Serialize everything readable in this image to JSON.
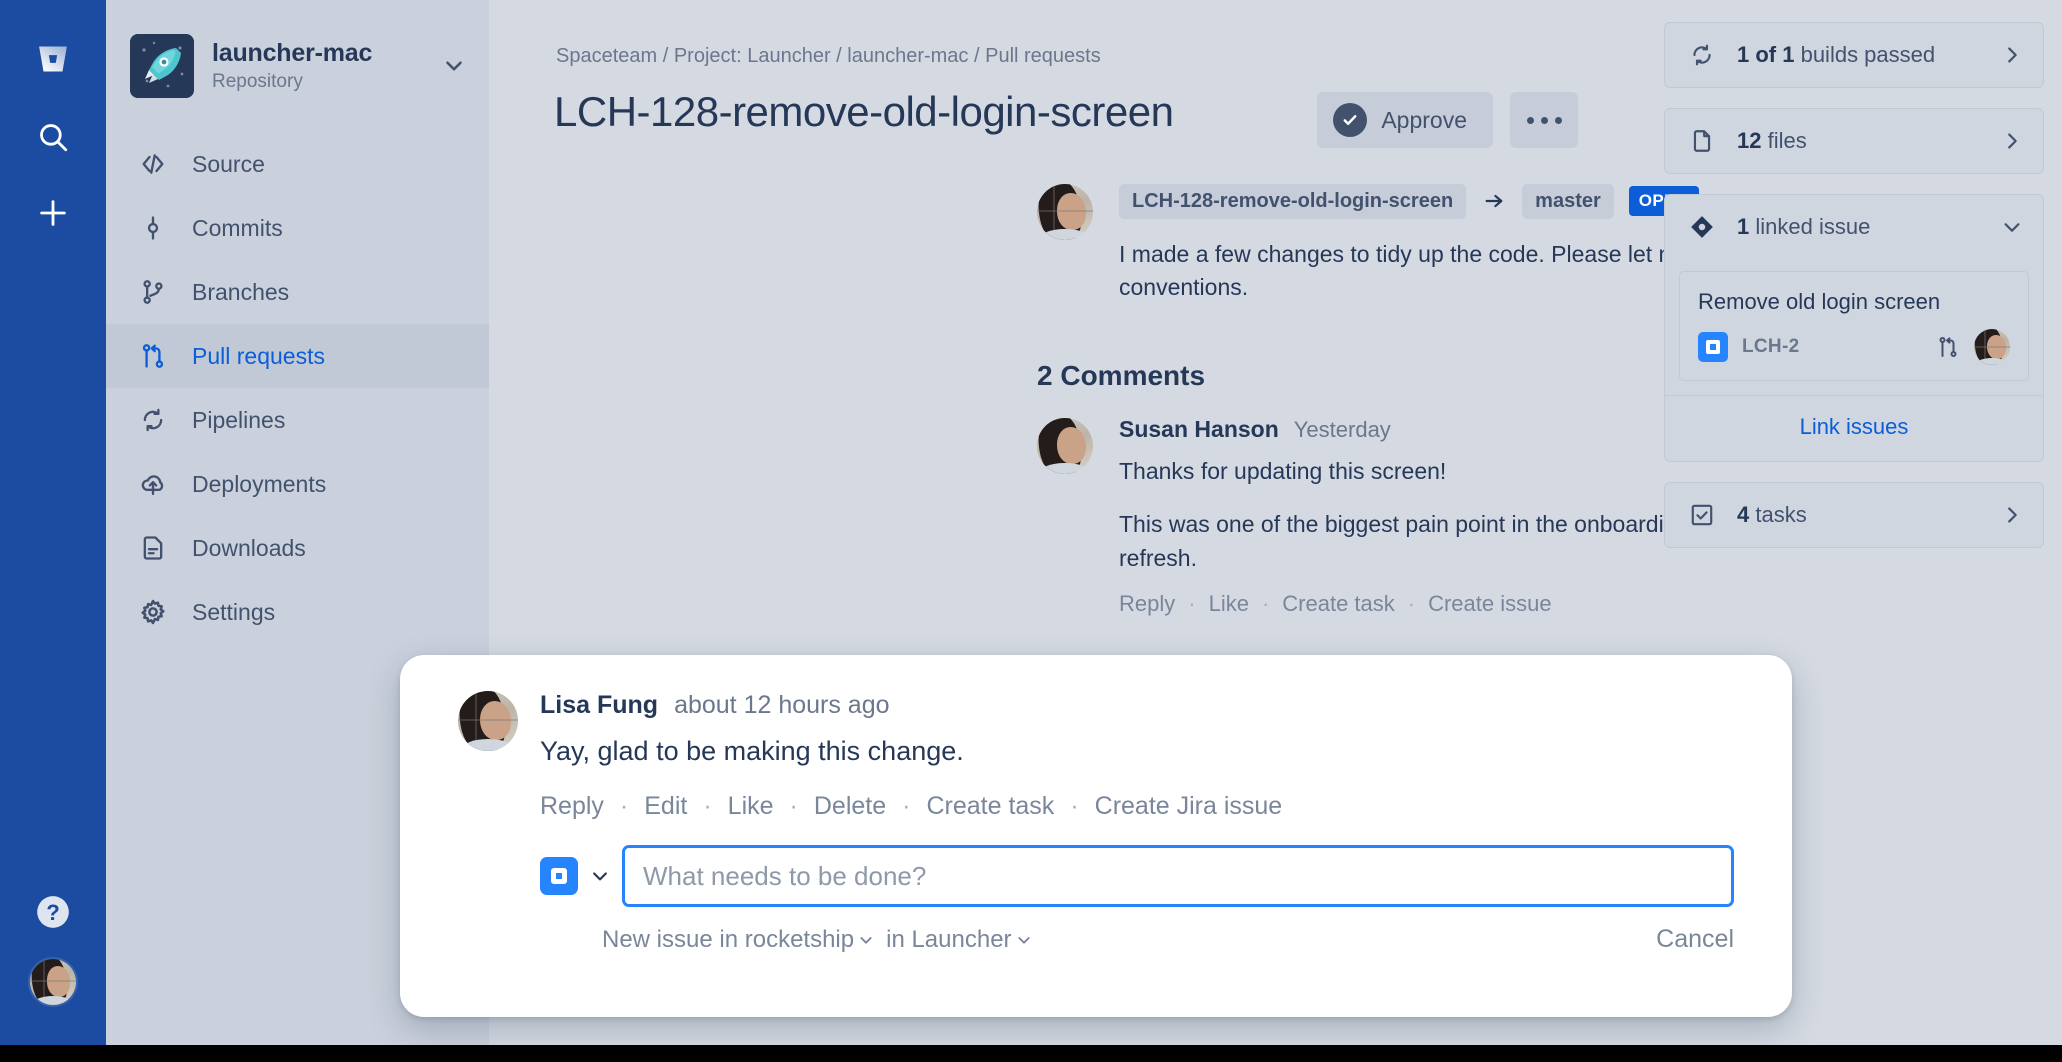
{
  "colors": {
    "brand_blue": "#1B4CA1",
    "accent_blue": "#0B5ED7",
    "link_blue": "#2684FF",
    "sidebar_bg": "#CBD1DC",
    "content_bg": "#D5DAE2",
    "text_dark": "#253858",
    "text_muted": "#6B778C",
    "text_subtle": "#7A869A"
  },
  "global_rail": {
    "logo_icon": "bitbucket-logo-icon",
    "search_icon": "search-icon",
    "create_icon": "plus-icon",
    "help_icon": "help-icon",
    "avatar_icon": "user-avatar"
  },
  "sidebar": {
    "repo_name": "launcher-mac",
    "repo_type": "Repository",
    "repo_avatar_icon": "rocket-icon",
    "chevron_icon": "chevron-down-icon",
    "items": [
      {
        "label": "Source",
        "icon": "code-icon",
        "active": false
      },
      {
        "label": "Commits",
        "icon": "commits-icon",
        "active": false
      },
      {
        "label": "Branches",
        "icon": "branches-icon",
        "active": false
      },
      {
        "label": "Pull requests",
        "icon": "pull-request-icon",
        "active": true
      },
      {
        "label": "Pipelines",
        "icon": "pipelines-icon",
        "active": false
      },
      {
        "label": "Deployments",
        "icon": "deployments-icon",
        "active": false
      },
      {
        "label": "Downloads",
        "icon": "downloads-icon",
        "active": false
      },
      {
        "label": "Settings",
        "icon": "settings-gear-icon",
        "active": false
      }
    ]
  },
  "main": {
    "breadcrumb": "Spaceteam / Project: Launcher / launcher-mac / Pull requests",
    "pr_title": "LCH-128-remove-old-login-screen",
    "approve_label": "Approve",
    "approve_icon": "check-circle-icon",
    "more_icon": "more-ellipsis-icon",
    "source_branch": "LCH-128-remove-old-login-screen",
    "branch_arrow_icon": "arrow-right-icon",
    "target_branch": "master",
    "state_badge": "OPEN",
    "pr_description": "I made a few changes to tidy up the code. Please let me know if I followed the right conventions.",
    "comments_heading": "2 Comments",
    "comments": [
      {
        "author": "Susan Hanson",
        "time": "Yesterday",
        "paragraphs": [
          "Thanks for updating this screen!",
          "This was one of the biggest pain point in the onboarding experience. About time it gets a refresh."
        ],
        "actions": [
          "Reply",
          "Like",
          "Create task",
          "Create issue"
        ]
      }
    ]
  },
  "right_panel": {
    "builds": {
      "count_text": "1 of 1",
      "label": " builds passed",
      "icon": "pipelines-icon",
      "caret": "chevron-right-icon"
    },
    "files": {
      "count_text": "12",
      "label": " files",
      "icon": "file-icon",
      "caret": "chevron-right-icon"
    },
    "linked_issue": {
      "count_text": "1",
      "label": " linked issue",
      "icon": "jira-diamond-icon",
      "caret": "chevron-down-icon",
      "issue_title": "Remove old login screen",
      "issue_key": "LCH-2",
      "issue_type_icon": "task-square-icon",
      "issue_pr_icon": "pull-request-icon",
      "issue_assignee_icon": "user-avatar",
      "link_issues_label": "Link issues"
    },
    "tasks": {
      "count_text": "4",
      "label": " tasks",
      "icon": "checkbox-icon",
      "caret": "chevron-right-icon"
    }
  },
  "modal": {
    "author": "Lisa Fung",
    "time": "about 12 hours ago",
    "text": "Yay, glad to be making this change.",
    "avatar_icon": "user-avatar",
    "actions": [
      "Reply",
      "Edit",
      "Like",
      "Delete",
      "Create task",
      "Create Jira issue"
    ],
    "task_type_icon": "task-square-icon",
    "task_type_caret": "chevron-down-icon",
    "task_input_value": "",
    "task_input_placeholder": "What needs to be done?",
    "issue_type_select": "New issue in rocketship",
    "issue_type_caret": "chevron-down-icon",
    "project_select": "in Launcher",
    "project_caret": "chevron-down-icon",
    "cancel_label": "Cancel"
  }
}
